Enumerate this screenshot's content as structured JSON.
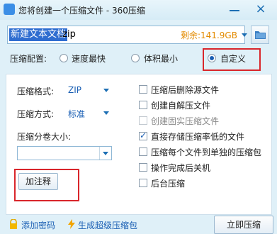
{
  "window": {
    "title": "您将创建一个压缩文件 - 360压缩",
    "close_glyph": "×"
  },
  "filename": {
    "selected": "新建文本文档",
    "extension": ".zip",
    "free_space": "剩余:141.9GB"
  },
  "config": {
    "label": "压缩配置:",
    "options": [
      {
        "label": "速度最快",
        "selected": false
      },
      {
        "label": "体积最小",
        "selected": false
      },
      {
        "label": "自定义",
        "selected": true
      }
    ]
  },
  "left": {
    "format_label": "压缩格式:",
    "format_value": "ZIP",
    "method_label": "压缩方式:",
    "method_value": "标准",
    "volume_label": "压缩分卷大小:",
    "volume_value": "",
    "comment_button": "加注释"
  },
  "right": {
    "options": [
      {
        "label": "压缩后删除源文件",
        "checked": false,
        "disabled": false
      },
      {
        "label": "创建自解压文件",
        "checked": false,
        "disabled": false
      },
      {
        "label": "创建固实压缩文件",
        "checked": false,
        "disabled": true
      },
      {
        "label": "直接存储压缩率低的文件",
        "checked": true,
        "disabled": false
      },
      {
        "label": "压缩每个文件到单独的压缩包",
        "checked": false,
        "disabled": false
      },
      {
        "label": "操作完成后关机",
        "checked": false,
        "disabled": false
      },
      {
        "label": "后台压缩",
        "checked": false,
        "disabled": false
      }
    ]
  },
  "bottom": {
    "add_password": "添加密码",
    "super_archive": "生成超级压缩包",
    "compress_now": "立即压缩"
  },
  "colors": {
    "accent": "#1a5fb4",
    "highlight": "#d9262b",
    "free_space": "#e38b00"
  }
}
